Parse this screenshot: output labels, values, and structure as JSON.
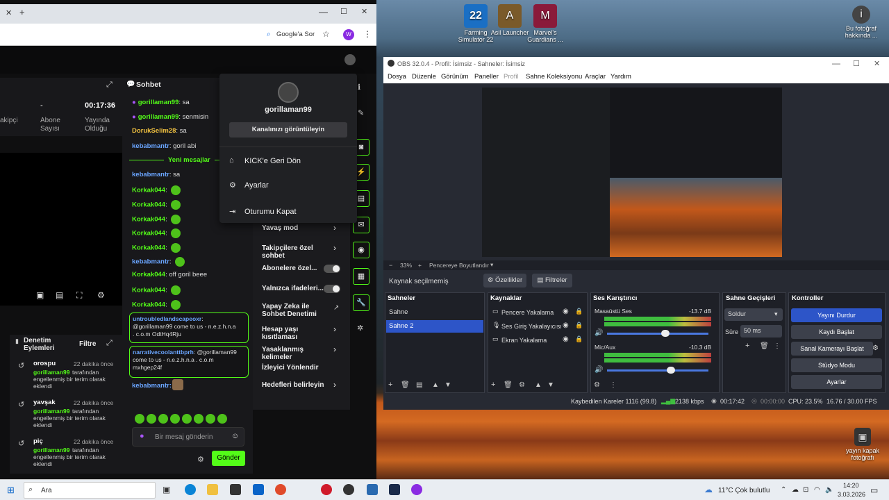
{
  "desktop": {
    "icons": [
      {
        "label": "Farming Simulator 22",
        "color": "#1a6fc4",
        "glyph": "22"
      },
      {
        "label": "Asil Launcher",
        "color": "#7a5a2a",
        "glyph": "A"
      },
      {
        "label": "Marvel's Guardians ...",
        "color": "#8a1a3a",
        "glyph": "M"
      },
      {
        "label": "Bu fotoğraf hakkında ...",
        "color": "#444",
        "glyph": "i"
      },
      {
        "label": "yayın kapak fotoğrafı",
        "color": "#333",
        "glyph": "▣"
      }
    ]
  },
  "browser": {
    "tab_new": "+",
    "window_controls": [
      "—",
      "☐",
      "✕"
    ],
    "addr_action": "Google'a Sor",
    "profile_letter": "W"
  },
  "kick": {
    "stats": {
      "followers_partial": "akipçi",
      "subs_value": "-",
      "subs_label": "Abone Sayısı",
      "time_value": "00:17:36",
      "time_label": "Yayında Olduğu"
    },
    "chat_title": "Sohbet",
    "new_messages": "Yeni mesajlar",
    "chat": [
      {
        "user": "gorillaman99",
        "text": "sa",
        "color": "green",
        "badge": true
      },
      {
        "user": "gorillaman99",
        "text": "senmisin",
        "color": "green",
        "badge": true
      },
      {
        "user": "DorukSelim28",
        "text": "sa",
        "color": "yellow"
      },
      {
        "user": "kebabmantr",
        "text": "goril abi",
        "color": "blue"
      }
    ],
    "chat_after": [
      {
        "user": "kebabmantr",
        "text": "sa",
        "color": "blue"
      },
      {
        "user": "Korkak044",
        "text": "",
        "color": "green",
        "emote": true
      },
      {
        "user": "Korkak044",
        "text": "",
        "color": "green",
        "emote": true
      },
      {
        "user": "Korkak044",
        "text": "",
        "color": "green",
        "emote": true
      },
      {
        "user": "Korkak044",
        "text": "",
        "color": "green",
        "emote": true
      },
      {
        "user": "Korkak044",
        "text": "",
        "color": "green",
        "emote": true
      },
      {
        "user": "kebabmantr",
        "text": "",
        "color": "blue",
        "emote": true
      },
      {
        "user": "Korkak044",
        "text": "off goril beee",
        "color": "green"
      },
      {
        "user": "Korkak044",
        "text": "",
        "color": "green",
        "emote": true
      },
      {
        "user": "Korkak044",
        "text": "",
        "color": "green",
        "emote": true
      }
    ],
    "flagged": [
      {
        "user": "untroubledlandscapeoxr",
        "lines": [
          "@gorillaman99 come to us - n.e.z.h.n.a",
          ". c.o.m OdtHq4Rju"
        ]
      },
      {
        "user": "narrativecoolanttbprh",
        "lines": [
          ": @gorillaman99",
          "come to us - n.e.z.h.n.a . c.o.m",
          "mxhgep24f"
        ]
      }
    ],
    "last_chat_user": "kebabmantr",
    "input_placeholder": "Bir mesaj gönderin",
    "send_label": "Gönder",
    "mod_title": "Denetim Eylemleri",
    "mod_filter": "Filtre",
    "mod_entries": [
      {
        "term": "orospu",
        "time": "22 dakika önce",
        "by": "gorillaman99",
        "desc1": "tarafından",
        "desc2": "engellenmiş bir terim olarak",
        "desc3": "eklendi"
      },
      {
        "term": "yavşak",
        "time": "22 dakika önce",
        "by": "gorillaman99",
        "desc1": "tarafından",
        "desc2": "engellenmiş bir terim olarak",
        "desc3": "eklendi"
      },
      {
        "term": "piç",
        "time": "22 dakika önce",
        "by": "gorillaman99",
        "desc1": "tarafından",
        "desc2": "engellenmiş bir terim olarak",
        "desc3": "eklendi"
      }
    ],
    "settings_menu": [
      {
        "label": "Yavaş mod",
        "type": "arrow"
      },
      {
        "label": "Takipçilere özel sohbet",
        "type": "arrow"
      },
      {
        "label": "Abonelere özel...",
        "type": "toggle"
      },
      {
        "label": "Yalnızca ifadeleri...",
        "type": "toggle"
      },
      {
        "label": "Yapay Zeka ile Sohbet Denetimi",
        "type": "link"
      },
      {
        "label": "Hesap yaşı kısıtlaması",
        "type": "arrow"
      },
      {
        "label": "Yasaklanmış kelimeler",
        "type": "arrow"
      },
      {
        "label": "İzleyici Yönlendir",
        "type": "none"
      },
      {
        "label": "Hedefleri belirleyin",
        "type": "arrow"
      }
    ],
    "dropdown": {
      "username": "gorillaman99",
      "view_channel": "Kanalınızı görüntüleyin",
      "items": [
        "KICK'e Geri Dön",
        "Ayarlar",
        "Oturumu Kapat"
      ]
    }
  },
  "obs": {
    "title": "OBS 32.0.4 - Profil: İsimsiz - Sahneler: İsimsiz",
    "menu": [
      "Dosya",
      "Düzenle",
      "Görünüm",
      "Paneller",
      "Profil",
      "Sahne Koleksiyonu",
      "Araçlar",
      "Yardım"
    ],
    "zoom": "33%",
    "fit": "Pencereye Boyutlandır",
    "no_source": "Kaynak seçilmemiş",
    "properties": "Özellikler",
    "filters": "Filtreler",
    "docks": {
      "scenes": "Sahneler",
      "sources": "Kaynaklar",
      "mixer": "Ses Karıştırıcı",
      "transitions": "Sahne Geçişleri",
      "controls": "Kontroller"
    },
    "scenes": [
      "Sahne",
      "Sahne 2"
    ],
    "sources": [
      "Pencere Yakalama",
      "Ses Giriş Yakalayıcısı",
      "Ekran Yakalama"
    ],
    "mixer": [
      {
        "name": "Masaüstü Ses",
        "db": "-13.7 dB"
      },
      {
        "name": "Mic/Aux",
        "db": "-10.3 dB"
      }
    ],
    "transition": "Soldur",
    "duration_label": "Süre",
    "duration": "50 ms",
    "controls": [
      "Yayını Durdur",
      "Kaydı Başlat",
      "Sanal Kamerayı Başlat",
      "Stüdyo Modu",
      "Ayarlar"
    ],
    "status": {
      "dropped": "Kaybedilen Kareler 1116 (99.8)",
      "bitrate": "2138 kbps",
      "live": "00:17:42",
      "rec": "00:00:00",
      "cpu": "CPU: 23.5%",
      "fps": "16.76 / 30.00 FPS"
    }
  },
  "taskbar": {
    "search": "Ara",
    "weather": "11°C  Çok bulutlu",
    "time": "14:20",
    "date": "3.03.2026"
  }
}
